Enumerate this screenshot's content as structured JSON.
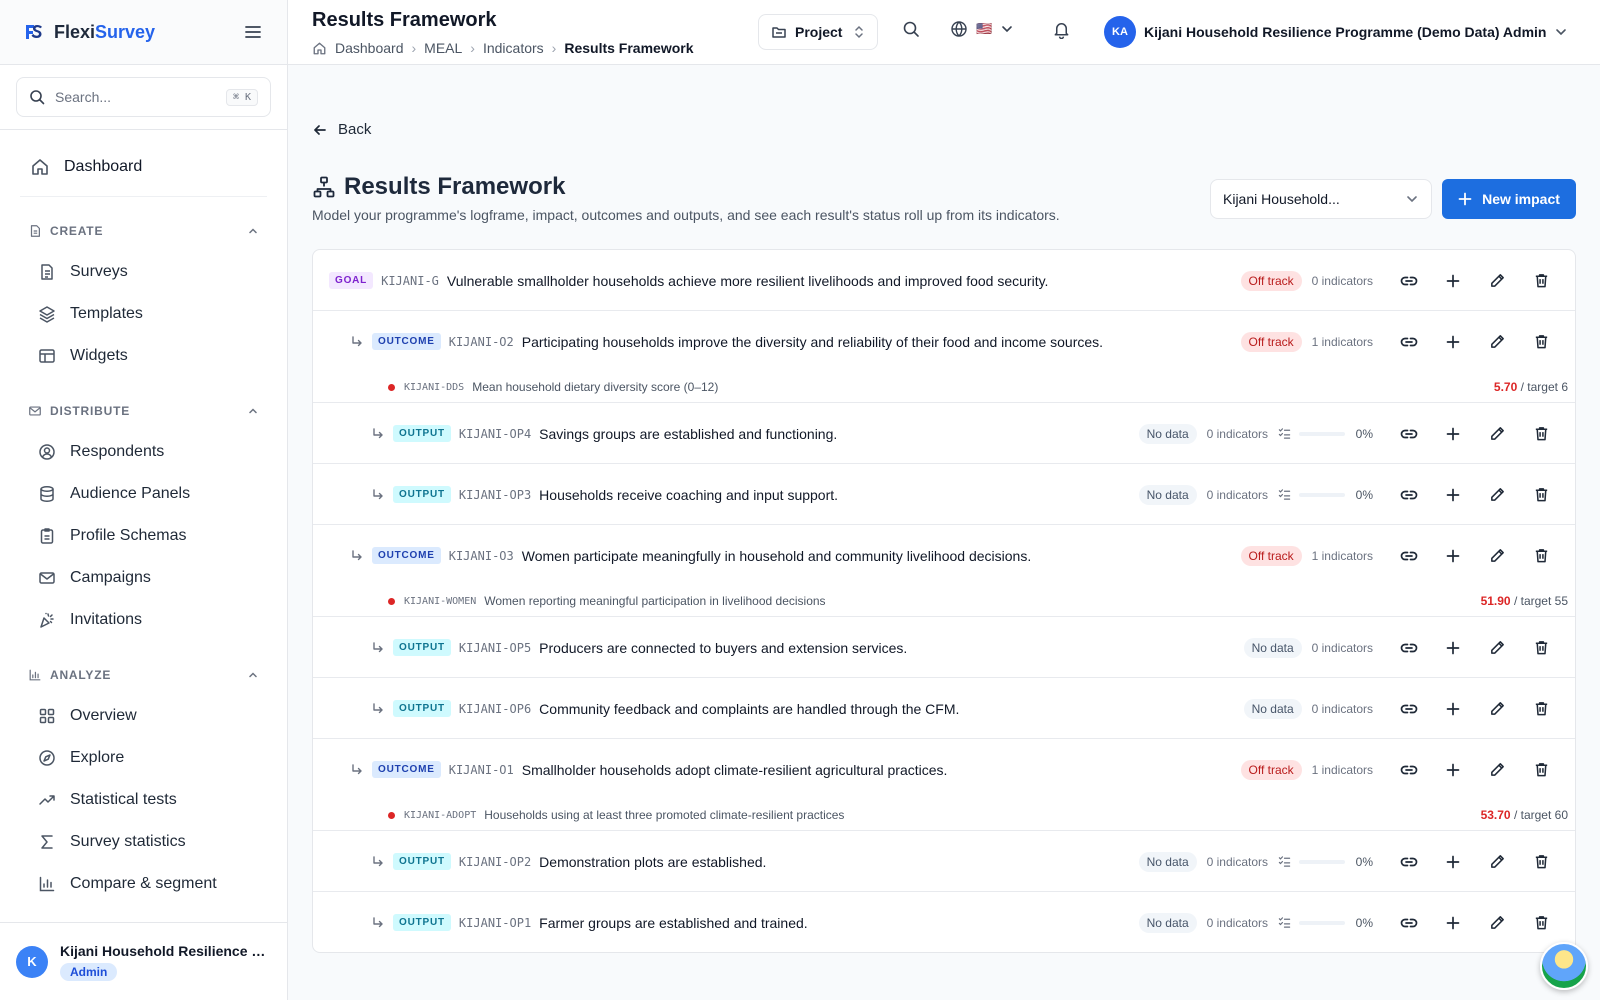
{
  "app": {
    "brand_prefix": "Flexi",
    "brand_suffix": "Survey"
  },
  "sidebar": {
    "search_placeholder": "Search...",
    "search_shortcut": "⌘ K",
    "dashboard": "Dashboard",
    "sections": [
      {
        "title": "CREATE",
        "items": [
          "Surveys",
          "Templates",
          "Widgets"
        ]
      },
      {
        "title": "DISTRIBUTE",
        "items": [
          "Respondents",
          "Audience Panels",
          "Profile Schemas",
          "Campaigns",
          "Invitations"
        ]
      },
      {
        "title": "ANALYZE",
        "items": [
          "Overview",
          "Explore",
          "Statistical tests",
          "Survey statistics",
          "Compare & segment"
        ]
      }
    ],
    "user": {
      "initial": "K",
      "name": "Kijani Household Resilience Programme (Demo Data)",
      "role": "Admin"
    }
  },
  "header": {
    "title": "Results Framework",
    "breadcrumb": [
      "Dashboard",
      "MEAL",
      "Indicators",
      "Results Framework"
    ],
    "project_label": "Project",
    "flag": "🇺🇸",
    "account_initials": "KA",
    "account_name": "Kijani Household Resilience Programme (Demo Data) Admin"
  },
  "main": {
    "back_label": "Back",
    "title": "Results Framework",
    "subtitle": "Model your programme's logframe, impact, outcomes and outputs, and see each result's status roll up from its indicators.",
    "program_select": "Kijani Household...",
    "new_impact_label": "New impact"
  },
  "rows": [
    {
      "level": 0,
      "type": "GOAL",
      "code": "KIJANI-G",
      "title": "Vulnerable smallholder households achieve more resilient livelihoods and improved food security.",
      "status": "Off track",
      "indicators": "0 indicators"
    },
    {
      "level": 1,
      "type": "OUTCOME",
      "code": "KIJANI-O2",
      "title": "Participating households improve the diversity and reliability of their food and income sources.",
      "status": "Off track",
      "indicators": "1 indicators",
      "indicator": {
        "code": "KIJANI-DDS",
        "name": "Mean household dietary diversity score (0–12)",
        "value": "5.70",
        "target": "/ target 6"
      }
    },
    {
      "level": 2,
      "type": "OUTPUT",
      "code": "KIJANI-OP4",
      "title": "Savings groups are established and functioning.",
      "status": "No data",
      "indicators": "0 indicators",
      "progress": 0,
      "progress_label": "0%"
    },
    {
      "level": 2,
      "type": "OUTPUT",
      "code": "KIJANI-OP3",
      "title": "Households receive coaching and input support.",
      "status": "No data",
      "indicators": "0 indicators",
      "progress": 0,
      "progress_label": "0%"
    },
    {
      "level": 1,
      "type": "OUTCOME",
      "code": "KIJANI-O3",
      "title": "Women participate meaningfully in household and community livelihood decisions.",
      "status": "Off track",
      "indicators": "1 indicators",
      "indicator": {
        "code": "KIJANI-WOMEN",
        "name": "Women reporting meaningful participation in livelihood decisions",
        "value": "51.90",
        "target": "/ target 55"
      }
    },
    {
      "level": 2,
      "type": "OUTPUT",
      "code": "KIJANI-OP5",
      "title": "Producers are connected to buyers and extension services.",
      "status": "No data",
      "indicators": "0 indicators"
    },
    {
      "level": 2,
      "type": "OUTPUT",
      "code": "KIJANI-OP6",
      "title": "Community feedback and complaints are handled through the CFM.",
      "status": "No data",
      "indicators": "0 indicators"
    },
    {
      "level": 1,
      "type": "OUTCOME",
      "code": "KIJANI-O1",
      "title": "Smallholder households adopt climate-resilient agricultural practices.",
      "status": "Off track",
      "indicators": "1 indicators",
      "indicator": {
        "code": "KIJANI-ADOPT",
        "name": "Households using at least three promoted climate-resilient practices",
        "value": "53.70",
        "target": "/ target 60"
      }
    },
    {
      "level": 2,
      "type": "OUTPUT",
      "code": "KIJANI-OP2",
      "title": "Demonstration plots are established.",
      "status": "No data",
      "indicators": "0 indicators",
      "progress": 0,
      "progress_label": "0%"
    },
    {
      "level": 2,
      "type": "OUTPUT",
      "code": "KIJANI-OP1",
      "title": "Farmer groups are established and trained.",
      "status": "No data",
      "indicators": "0 indicators",
      "progress": 0,
      "progress_label": "0%"
    }
  ]
}
